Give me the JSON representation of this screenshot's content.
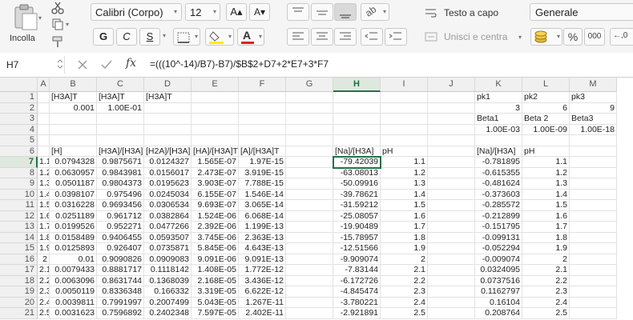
{
  "ribbon": {
    "paste_label": "Incolla",
    "font_name": "Calibri (Corpo)",
    "font_size": "12",
    "increase_font": "A▴",
    "decrease_font": "A▾",
    "bold": "G",
    "italic": "C",
    "underline": "S",
    "wrap_text": "Testo a capo",
    "merge_center": "Unisci e centra",
    "number_format": "Generale",
    "percent": "%",
    "thousands": "000",
    "accent_color": "#217346",
    "fill_color": "#ffeb00",
    "font_color": "#e02020"
  },
  "formula_bar": {
    "name_box": "H7",
    "fx": "fx",
    "formula": "=(((10^-14)/B7)-B7)/$B$2+D7+2*E7+3*F7"
  },
  "grid": {
    "columns": [
      "A",
      "B",
      "C",
      "D",
      "E",
      "F",
      "G",
      "H",
      "I",
      "J",
      "K",
      "L",
      "M"
    ],
    "selected_column": "H",
    "selected_row": "7",
    "rows": [
      {
        "n": "1",
        "cells": [
          "",
          "[H3A]T",
          "[H3A]T",
          "[H3A]T",
          "",
          "",
          "",
          "",
          "",
          "",
          "pk1",
          "pk2",
          "pk3"
        ]
      },
      {
        "n": "2",
        "cells": [
          "",
          "0.001",
          "1.00E-01",
          "",
          "",
          "",
          "",
          "",
          "",
          "",
          "3",
          "6",
          "9"
        ]
      },
      {
        "n": "3",
        "cells": [
          "",
          "",
          "",
          "",
          "",
          "",
          "",
          "",
          "",
          "",
          "Beta1",
          "Beta 2",
          "Beta3"
        ]
      },
      {
        "n": "4",
        "cells": [
          "",
          "",
          "",
          "",
          "",
          "",
          "",
          "",
          "",
          "",
          "1.00E-03",
          "1.00E-09",
          "1.00E-18"
        ]
      },
      {
        "n": "5",
        "cells": [
          "",
          "",
          "",
          "",
          "",
          "",
          "",
          "",
          "",
          "",
          "",
          "",
          ""
        ]
      },
      {
        "n": "6",
        "cells": [
          "",
          "[H]",
          "[H3A]/[H3A]",
          "[H2A]/[H3A]",
          "[HA]/[H3A]T",
          "[A]/[H3A]T",
          "",
          "[Na]/[H3A]",
          "pH",
          "",
          "[Na]/[H3A]",
          "pH",
          ""
        ]
      },
      {
        "n": "7",
        "cells": [
          "1.1",
          "0.0794328",
          "0.9875671",
          "0.0124327",
          "1.565E-07",
          "1.97E-15",
          "",
          "-79.42039",
          "1.1",
          "",
          "-0.781895",
          "1.1",
          ""
        ]
      },
      {
        "n": "8",
        "cells": [
          "1.2",
          "0.0630957",
          "0.9843981",
          "0.0156017",
          "2.473E-07",
          "3.919E-15",
          "",
          "-63.08013",
          "1.2",
          "",
          "-0.615355",
          "1.2",
          ""
        ]
      },
      {
        "n": "9",
        "cells": [
          "1.3",
          "0.0501187",
          "0.9804373",
          "0.0195623",
          "3.903E-07",
          "7.788E-15",
          "",
          "-50.09916",
          "1.3",
          "",
          "-0.481624",
          "1.3",
          ""
        ]
      },
      {
        "n": "10",
        "cells": [
          "1.4",
          "0.0398107",
          "0.975496",
          "0.0245034",
          "6.155E-07",
          "1.546E-14",
          "",
          "-39.78621",
          "1.4",
          "",
          "-0.373603",
          "1.4",
          ""
        ]
      },
      {
        "n": "11",
        "cells": [
          "1.5",
          "0.0316228",
          "0.9693456",
          "0.0306534",
          "9.693E-07",
          "3.065E-14",
          "",
          "-31.59212",
          "1.5",
          "",
          "-0.285572",
          "1.5",
          ""
        ]
      },
      {
        "n": "12",
        "cells": [
          "1.6",
          "0.0251189",
          "0.961712",
          "0.0382864",
          "1.524E-06",
          "6.068E-14",
          "",
          "-25.08057",
          "1.6",
          "",
          "-0.212899",
          "1.6",
          ""
        ]
      },
      {
        "n": "13",
        "cells": [
          "1.7",
          "0.0199526",
          "0.952271",
          "0.0477266",
          "2.392E-06",
          "1.199E-13",
          "",
          "-19.90489",
          "1.7",
          "",
          "-0.151795",
          "1.7",
          ""
        ]
      },
      {
        "n": "14",
        "cells": [
          "1.8",
          "0.0158489",
          "0.9406455",
          "0.0593507",
          "3.745E-06",
          "2.363E-13",
          "",
          "-15.78957",
          "1.8",
          "",
          "-0.099131",
          "1.8",
          ""
        ]
      },
      {
        "n": "15",
        "cells": [
          "1.9",
          "0.0125893",
          "0.926407",
          "0.0735871",
          "5.845E-06",
          "4.643E-13",
          "",
          "-12.51566",
          "1.9",
          "",
          "-0.052294",
          "1.9",
          ""
        ]
      },
      {
        "n": "16",
        "cells": [
          "2",
          "0.01",
          "0.9090826",
          "0.0909083",
          "9.091E-06",
          "9.091E-13",
          "",
          "-9.909074",
          "2",
          "",
          "-0.009074",
          "2",
          ""
        ]
      },
      {
        "n": "17",
        "cells": [
          "2.1",
          "0.0079433",
          "0.8881717",
          "0.1118142",
          "1.408E-05",
          "1.772E-12",
          "",
          "-7.83144",
          "2.1",
          "",
          "0.0324095",
          "2.1",
          ""
        ]
      },
      {
        "n": "18",
        "cells": [
          "2.2",
          "0.0063096",
          "0.8631744",
          "0.1368039",
          "2.168E-05",
          "3.436E-12",
          "",
          "-6.172726",
          "2.2",
          "",
          "0.0737516",
          "2.2",
          ""
        ]
      },
      {
        "n": "19",
        "cells": [
          "2.3",
          "0.0050119",
          "0.8336348",
          "0.166332",
          "3.319E-05",
          "6.622E-12",
          "",
          "-4.845474",
          "2.3",
          "",
          "0.1162797",
          "2.3",
          ""
        ]
      },
      {
        "n": "20",
        "cells": [
          "2.4",
          "0.0039811",
          "0.7991997",
          "0.2007499",
          "5.043E-05",
          "1.267E-11",
          "",
          "-3.780221",
          "2.4",
          "",
          "0.16104",
          "2.4",
          ""
        ]
      },
      {
        "n": "21",
        "cells": [
          "2.5",
          "0.0031623",
          "0.7596892",
          "0.2402348",
          "7.597E-05",
          "2.402E-11",
          "",
          "-2.921891",
          "2.5",
          "",
          "0.208764",
          "2.5",
          ""
        ]
      }
    ]
  }
}
